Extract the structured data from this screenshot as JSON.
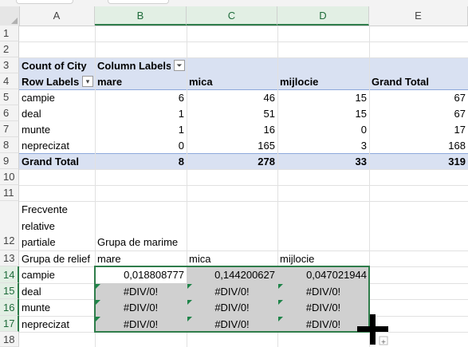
{
  "columns": [
    "A",
    "B",
    "C",
    "D",
    "E"
  ],
  "rows": [
    "1",
    "2",
    "3",
    "4",
    "5",
    "6",
    "7",
    "8",
    "9",
    "10",
    "11",
    "12",
    "13",
    "14",
    "15",
    "16",
    "17",
    "18"
  ],
  "pivot": {
    "count_label": "Count of City",
    "column_labels": "Column Labels",
    "row_labels": "Row Labels",
    "headers": [
      "mare",
      "mica",
      "mijlocie",
      "Grand Total"
    ],
    "rows": [
      {
        "label": "campie",
        "values": [
          "6",
          "46",
          "15",
          "67"
        ]
      },
      {
        "label": "deal",
        "values": [
          "1",
          "51",
          "15",
          "67"
        ]
      },
      {
        "label": "munte",
        "values": [
          "1",
          "16",
          "0",
          "17"
        ]
      },
      {
        "label": "neprecizat",
        "values": [
          "0",
          "165",
          "3",
          "168"
        ]
      }
    ],
    "grand_total": {
      "label": "Grand Total",
      "values": [
        "8",
        "278",
        "33",
        "319"
      ]
    }
  },
  "freq": {
    "title_lines": [
      "Frecvente",
      "relative",
      "partiale"
    ],
    "group_label": "Grupa de marime",
    "relief_label": "Grupa de relief",
    "headers": [
      "mare",
      "mica",
      "mijlocie"
    ],
    "rows": [
      {
        "label": "campie",
        "values": [
          "0,018808777",
          "0,144200627",
          "0,047021944"
        ]
      },
      {
        "label": "deal",
        "values": [
          "#DIV/0!",
          "#DIV/0!",
          "#DIV/0!"
        ]
      },
      {
        "label": "munte",
        "values": [
          "#DIV/0!",
          "#DIV/0!",
          "#DIV/0!"
        ]
      },
      {
        "label": "neprecizat",
        "values": [
          "#DIV/0!",
          "#DIV/0!",
          "#DIV/0!"
        ]
      }
    ]
  },
  "colors": {
    "pivot_band": "#d9e1f2",
    "selection": "#2f7d4b",
    "error_triangle": "#1e8449"
  },
  "icons": {
    "filter": "filter-funnel-icon",
    "dropdown": "dropdown-arrow-icon",
    "cursor": "crosshair-cursor-icon"
  }
}
